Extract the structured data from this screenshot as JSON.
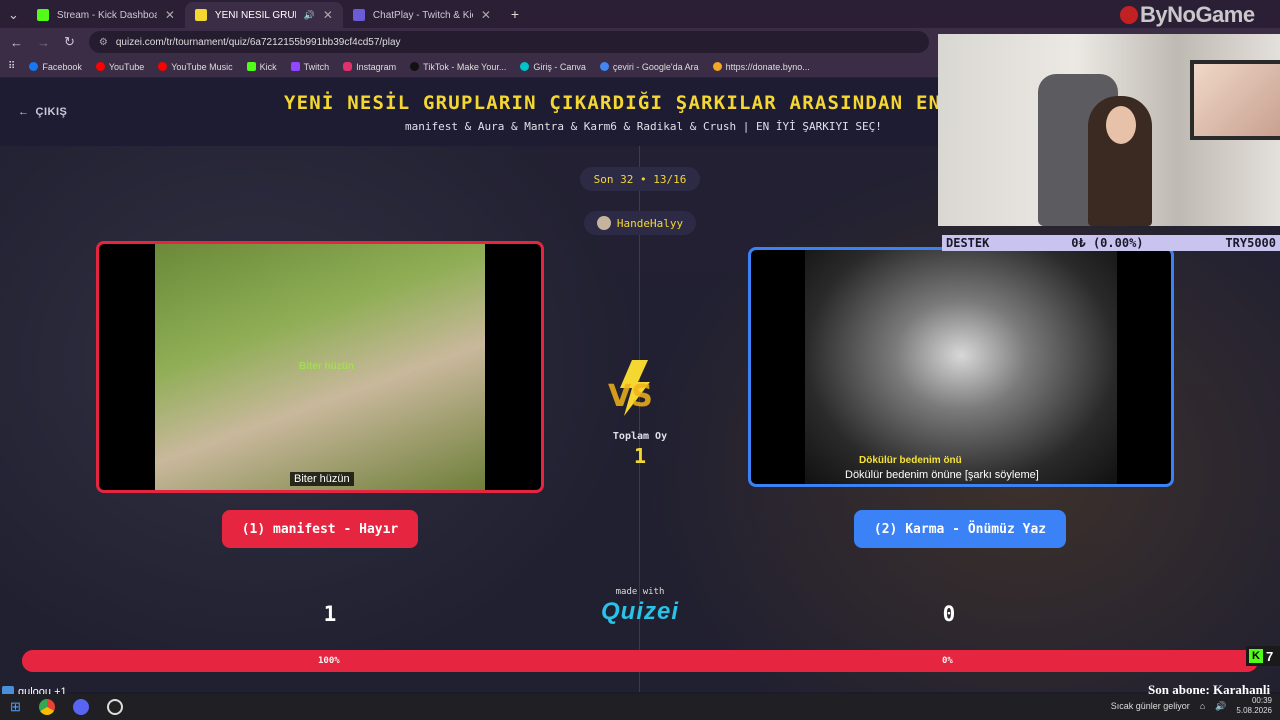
{
  "browser": {
    "tabs": [
      {
        "title": "Stream - Kick Dashboard",
        "favicon_color": "#53fc18",
        "active": false
      },
      {
        "title": "YENİ NESİL GRUPLARIN ÇIK",
        "favicon_color": "#f5d731",
        "active": true
      },
      {
        "title": "ChatPlay - Twitch & Kick İzleyic",
        "favicon_color": "#6b5bd6",
        "active": false
      }
    ],
    "new_tab": "+",
    "url": "quizei.com/tr/tournament/quiz/6a7212155b991bb39cf4cd57/play",
    "bookmarks": [
      {
        "label": "Facebook",
        "color": "#1877f2"
      },
      {
        "label": "YouTube",
        "color": "#ff0000"
      },
      {
        "label": "YouTube Music",
        "color": "#ff0000"
      },
      {
        "label": "Kick",
        "color": "#53fc18"
      },
      {
        "label": "Twitch",
        "color": "#9146ff"
      },
      {
        "label": "Instagram",
        "color": "#e1306c"
      },
      {
        "label": "TikTok - Make Your...",
        "color": "#111111"
      },
      {
        "label": "Giriş - Canva",
        "color": "#00c4cc"
      },
      {
        "label": "çeviri - Google'da Ara",
        "color": "#4285f4"
      },
      {
        "label": "https://donate.byno...",
        "color": "#f5a623"
      }
    ]
  },
  "quiz": {
    "exit_label": "ÇIKIŞ",
    "title": "YENİ NESİL GRUPLARIN ÇIKARDIĞI ŞARKILAR ARASINDAN EN İ",
    "subtitle": "manifest & Aura & Mantra & Karm6 & Radikal & Crush | EN İYİ ŞARKIYI SEÇ!",
    "round": "Son 32 • 13/16",
    "username": "HandeHalyy",
    "total_votes_label": "Toplam Oy",
    "total_votes": "1",
    "vs_label": "VS",
    "left": {
      "caption": "Biter hüzün",
      "overlay_caption": "Biter hüzün",
      "option_label": "(1) manifest - Hayır",
      "score": "1",
      "percent_label": "100%",
      "percent": 1.0,
      "color": "#e62540"
    },
    "right": {
      "caption_yellow": "Dökülür bedenim önü",
      "caption": "Dökülür bedenim önüne [şarkı söyleme]",
      "option_label": "(2) Karma - Önümüz Yaz",
      "score": "0",
      "percent_label": "0%",
      "percent": 0.0,
      "color": "#3b82f6"
    },
    "made_with": "made with",
    "brand": "QUIZEI"
  },
  "overlay": {
    "watermark": "ByNoGame",
    "donation": {
      "left": "DESTEK",
      "center": "0₺ (0.00%)",
      "right": "TRY5000"
    },
    "kick_count": "7",
    "chat_message": "guloou +1",
    "sub_ticker": "Son abone: Karahanli"
  },
  "taskbar": {
    "now_playing": "Sıcak günler geliyor",
    "time": "00:39",
    "date": "5.08.2026"
  }
}
